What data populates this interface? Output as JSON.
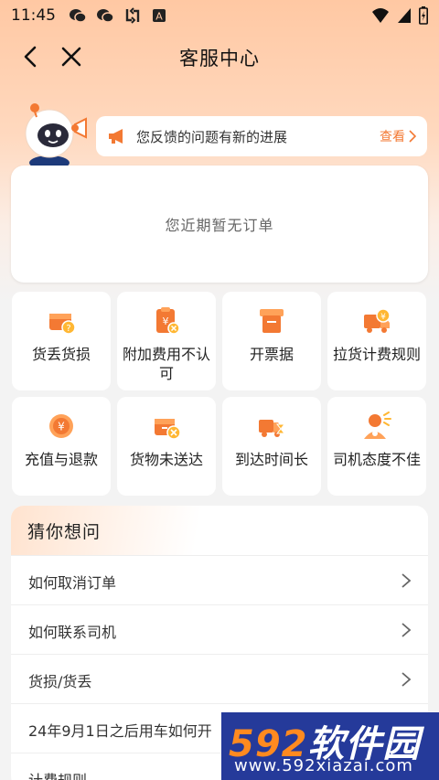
{
  "status_bar": {
    "time": "11:45",
    "icons": [
      "wechat-icon",
      "wechat-icon",
      "sync-icon",
      "a-icon",
      "wifi-icon",
      "signal-icon",
      "battery-icon"
    ]
  },
  "nav": {
    "title": "客服中心",
    "back_icon": "chevron-left-icon",
    "close_icon": "close-icon"
  },
  "notice": {
    "text": "您反馈的问题有新的进展",
    "link_label": "查看",
    "icon": "megaphone-icon"
  },
  "orders": {
    "empty_text": "您近期暂无订单"
  },
  "tiles": [
    {
      "label": "货丢货损",
      "icon": "lost-package-icon"
    },
    {
      "label": "附加费用不认可",
      "icon": "extra-fee-icon"
    },
    {
      "label": "开票据",
      "icon": "invoice-icon"
    },
    {
      "label": "拉货计费规则",
      "icon": "truck-fee-icon"
    },
    {
      "label": "充值与退款",
      "icon": "recharge-icon"
    },
    {
      "label": "货物未送达",
      "icon": "undelivered-icon"
    },
    {
      "label": "到达时间长",
      "icon": "truck-time-icon"
    },
    {
      "label": "司机态度不佳",
      "icon": "driver-icon"
    }
  ],
  "guess": {
    "title": "猜你想问",
    "questions": [
      "如何取消订单",
      "如何联系司机",
      "货损/货丢",
      "24年9月1日之后用车如何开",
      "计费规则"
    ]
  },
  "watermark": {
    "logo_prefix": "592",
    "logo_suffix": "软件园",
    "url": "www.592xiazai.com"
  },
  "colors": {
    "accent": "#f37933",
    "header_gradient_top": "#ffc8a3",
    "watermark_bg": "#253a9a"
  }
}
